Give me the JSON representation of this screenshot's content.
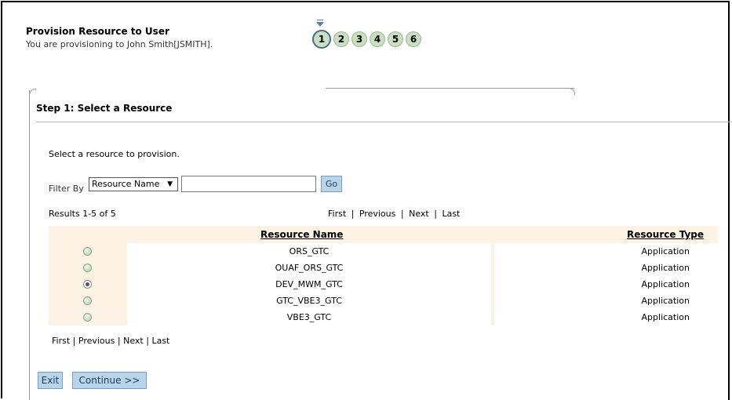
{
  "header": {
    "title": "Provision Resource to User",
    "subtitle": "You are provisioning to John Smith[JSMITH]."
  },
  "train": {
    "steps": [
      "1",
      "2",
      "3",
      "4",
      "5",
      "6"
    ],
    "active_index": 0
  },
  "step": {
    "title": "Step 1: Select a Resource",
    "instructions": "Select a resource to provision."
  },
  "filter": {
    "label": "Filter By",
    "selected": "Resource Name",
    "input_value": "",
    "go_label": "Go"
  },
  "results": {
    "summary": "Results 1-5 of 5",
    "nav": {
      "first": "First",
      "previous": "Previous",
      "next": "Next",
      "last": "Last",
      "separator": "|"
    }
  },
  "table": {
    "columns": [
      "Resource Name",
      "Resource Type"
    ],
    "rows": [
      {
        "name": "ORS_GTC",
        "type": "Application",
        "selected": false
      },
      {
        "name": "OUAF_ORS_GTC",
        "type": "Application",
        "selected": false
      },
      {
        "name": "DEV_MWM_GTC",
        "type": "Application",
        "selected": true
      },
      {
        "name": "GTC_VBE3_GTC",
        "type": "Application",
        "selected": false
      },
      {
        "name": "VBE3_GTC",
        "type": "Application",
        "selected": false
      }
    ]
  },
  "buttons": {
    "exit": "Exit",
    "continue": "Continue >>"
  },
  "colors": {
    "button_bg": "#b9d4ea",
    "row_tint": "#fcf3e4",
    "train_step": "#c9dfc1"
  }
}
